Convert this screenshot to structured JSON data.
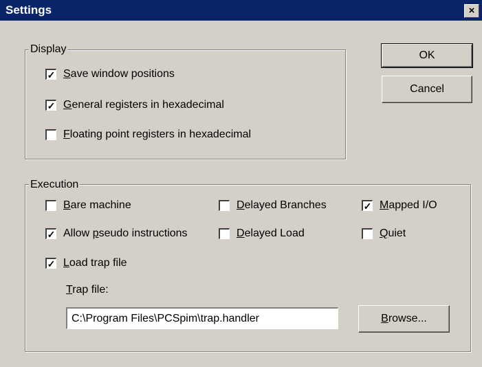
{
  "window": {
    "title": "Settings",
    "close_label": "×"
  },
  "buttons": {
    "ok": "OK",
    "cancel": "Cancel",
    "browse": "Browse..."
  },
  "display": {
    "legend": "Display",
    "save_window_positions": {
      "label": "Save window positions",
      "checked": true
    },
    "general_registers_hex": {
      "label": "General registers in hexadecimal",
      "checked": true
    },
    "floating_point_registers_hex": {
      "label": "Floating point registers in hexadecimal",
      "checked": false
    }
  },
  "execution": {
    "legend": "Execution",
    "bare_machine": {
      "label": "Bare machine",
      "checked": false
    },
    "allow_pseudo": {
      "label": "Allow pseudo instructions",
      "checked": true
    },
    "load_trap_file": {
      "label": "Load trap file",
      "checked": true
    },
    "delayed_branches": {
      "label": "Delayed Branches",
      "checked": false
    },
    "delayed_load": {
      "label": "Delayed Load",
      "checked": false
    },
    "mapped_io": {
      "label": "Mapped I/O",
      "checked": true
    },
    "quiet": {
      "label": "Quiet",
      "checked": false
    },
    "trap_file_label": "Trap file:",
    "trap_file_value": "C:\\Program Files\\PCSpim\\trap.handler"
  }
}
